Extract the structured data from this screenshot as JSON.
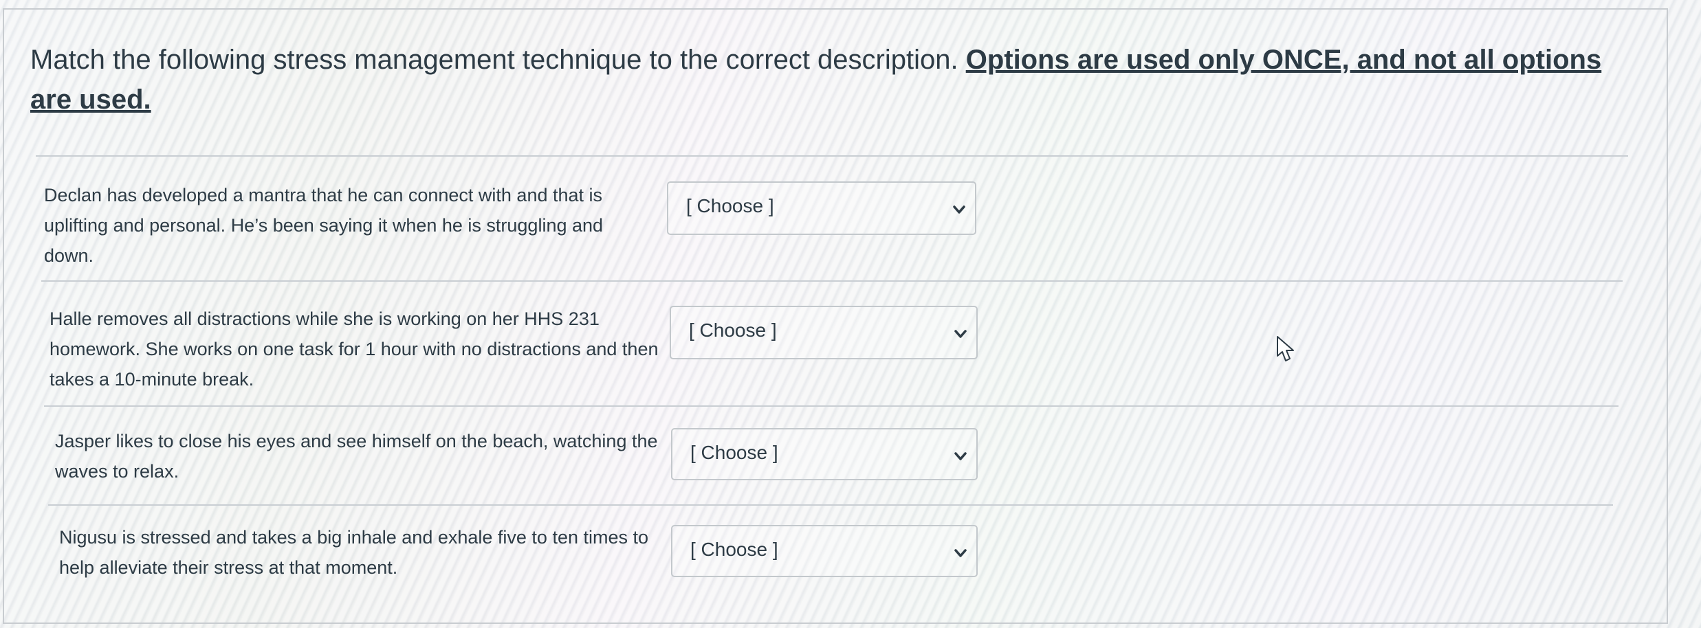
{
  "question": {
    "intro": "Match the following stress management technique to the correct description. ",
    "emphasis": "Options are used only ONCE, and not all options are used."
  },
  "rows": [
    {
      "prompt": "Declan has developed a mantra that he can connect with and that is uplifting and personal. He’s been saying it when he is struggling and down.",
      "selected": "[ Choose ]"
    },
    {
      "prompt": "Halle removes all distractions while she is working on her HHS 231 homework. She works on one task for 1 hour with no distractions and then takes a 10-minute break.",
      "selected": "[ Choose ]"
    },
    {
      "prompt": "Jasper likes to close his eyes and see himself on the beach, watching the waves to relax.",
      "selected": "[ Choose ]"
    },
    {
      "prompt": "Nigusu is stressed and takes a big inhale and exhale five to ten times to help alleviate their stress at that moment.",
      "selected": "[ Choose ]"
    }
  ],
  "icons": {
    "dropdown": "chevron-down-icon",
    "cursor": "mouse-pointer-icon"
  },
  "colors": {
    "text": "#2d3b45",
    "border": "#c3c8cc"
  }
}
